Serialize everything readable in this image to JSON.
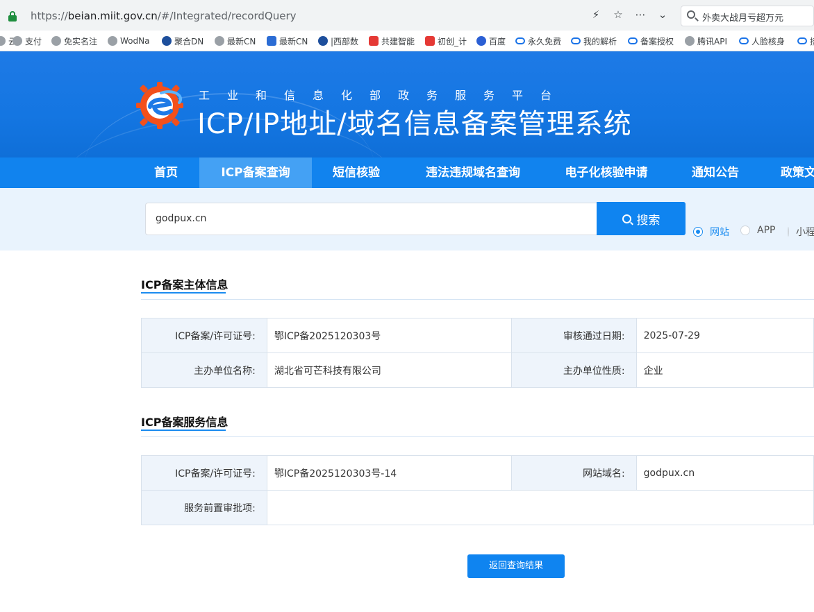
{
  "browser": {
    "url_prefix": "https://",
    "url_host": "beian.miit.gov.cn",
    "url_path": "/#/Integrated/recordQuery",
    "search_text": "外卖大战月亏超万元",
    "icons": [
      "lock-icon",
      "lightning-icon",
      "star-icon",
      "more-icon",
      "chevron-down-icon",
      "search-icon"
    ]
  },
  "bookmarks": [
    {
      "label": "云",
      "icon": "globe"
    },
    {
      "label": "支付",
      "icon": "globe"
    },
    {
      "label": "免实名注",
      "icon": "globe"
    },
    {
      "label": "WodNa",
      "icon": "globe"
    },
    {
      "label": "聚合DN",
      "icon": "dark"
    },
    {
      "label": "最新CN",
      "icon": "globe"
    },
    {
      "label": "最新CN",
      "icon": "blue"
    },
    {
      "label": "|西部数",
      "icon": "dark"
    },
    {
      "label": "共建智能",
      "icon": "red"
    },
    {
      "label": "初创_计",
      "icon": "red"
    },
    {
      "label": "百度",
      "icon": "paw"
    },
    {
      "label": "永久免费",
      "icon": "cloud"
    },
    {
      "label": "我的解析",
      "icon": "cloud"
    },
    {
      "label": "备案授权",
      "icon": "cloud"
    },
    {
      "label": "腾讯API",
      "icon": "globe"
    },
    {
      "label": "人脸核身",
      "icon": "cloud"
    },
    {
      "label": "接",
      "icon": "cloud"
    }
  ],
  "header": {
    "subtitle": "工业和信息化部政务服务平台",
    "title": "ICP/IP地址/域名信息备案管理系统"
  },
  "nav": {
    "items": [
      "首页",
      "ICP备案查询",
      "短信核验",
      "违法违规域名查询",
      "电子化核验申请",
      "通知公告",
      "政策文件"
    ],
    "active": "ICP备案查询"
  },
  "search": {
    "value": "godpux.cn",
    "button": "搜索",
    "options": [
      "网站",
      "APP",
      "小程序"
    ],
    "selected": "网站"
  },
  "section_subject": {
    "title": "ICP备案主体信息",
    "license_label": "ICP备案/许可证号:",
    "license_value": "鄂ICP备2025120303号",
    "approve_label": "审核通过日期:",
    "approve_value": "2025-07-29",
    "org_label": "主办单位名称:",
    "org_value": "湖北省可芒科技有限公司",
    "org_type_label": "主办单位性质:",
    "org_type_value": "企业"
  },
  "section_service": {
    "title": "ICP备案服务信息",
    "license_label": "ICP备案/许可证号:",
    "license_value": "鄂ICP备2025120303号-14",
    "domain_label": "网站域名:",
    "domain_value": "godpux.cn",
    "preapproval_label": "服务前置审批项:",
    "preapproval_value": ""
  },
  "back_button": "返回查询结果",
  "colors": {
    "primary": "#1183ee",
    "nav_active": "#44a1f4",
    "accent": "#1a8bf0",
    "key_cell_bg": "#eef4fb"
  }
}
